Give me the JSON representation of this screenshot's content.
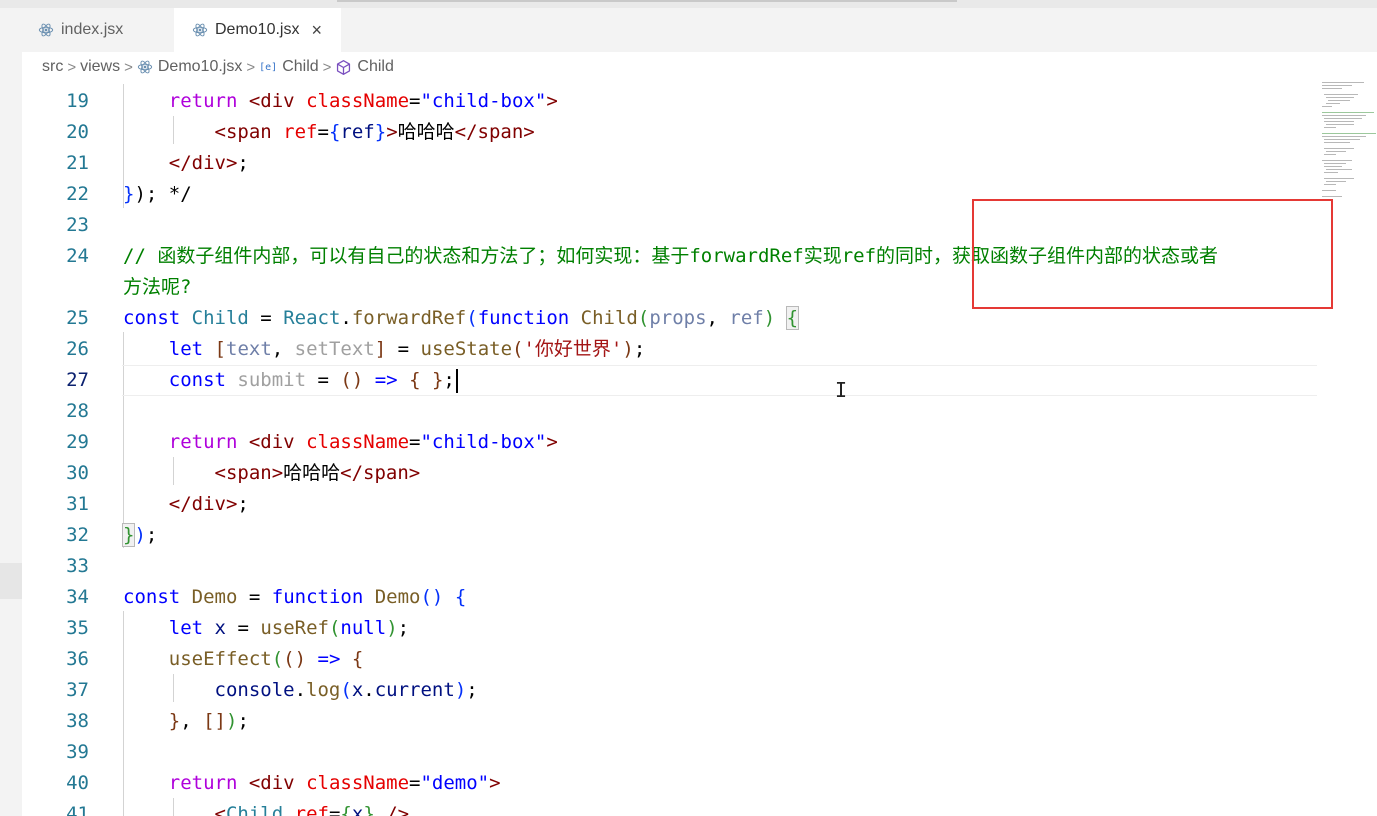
{
  "tabs": [
    {
      "label": "index.jsx",
      "icon": "react-icon",
      "active": false
    },
    {
      "label": "Demo10.jsx",
      "icon": "react-icon",
      "active": true,
      "close": "×"
    }
  ],
  "breadcrumb": {
    "items": [
      "src",
      "views",
      "Demo10.jsx",
      "Child",
      "Child"
    ],
    "separator": ">",
    "variable_icon_text": "[e]"
  },
  "editor": {
    "lines": [
      {
        "n": "19"
      },
      {
        "n": "20"
      },
      {
        "n": "21"
      },
      {
        "n": "22"
      },
      {
        "n": "23"
      },
      {
        "n": "24"
      },
      {
        "n": ""
      },
      {
        "n": "25"
      },
      {
        "n": "26"
      },
      {
        "n": "27"
      },
      {
        "n": "28"
      },
      {
        "n": "29"
      },
      {
        "n": "30"
      },
      {
        "n": "31"
      },
      {
        "n": "32"
      },
      {
        "n": "33"
      },
      {
        "n": "34"
      },
      {
        "n": "35"
      },
      {
        "n": "36"
      },
      {
        "n": "37"
      },
      {
        "n": "38"
      },
      {
        "n": "39"
      },
      {
        "n": "40"
      },
      {
        "n": "41"
      }
    ],
    "current_line": "27",
    "comment_line_24a": "// 函数子组件内部，可以有自己的状态和方法了；如何实现：基于forwardRef实现ref的同时，获取函数子组件内部的状态或者",
    "comment_line_24b": "方法呢?",
    "string_hello_world": "'你好世界'",
    "jsx_text_hahaha": "哈哈哈"
  },
  "colors": {
    "highlight_box": "#e53935",
    "keyword": "#0000ff",
    "comment": "#008000",
    "line_number": "#237893"
  }
}
